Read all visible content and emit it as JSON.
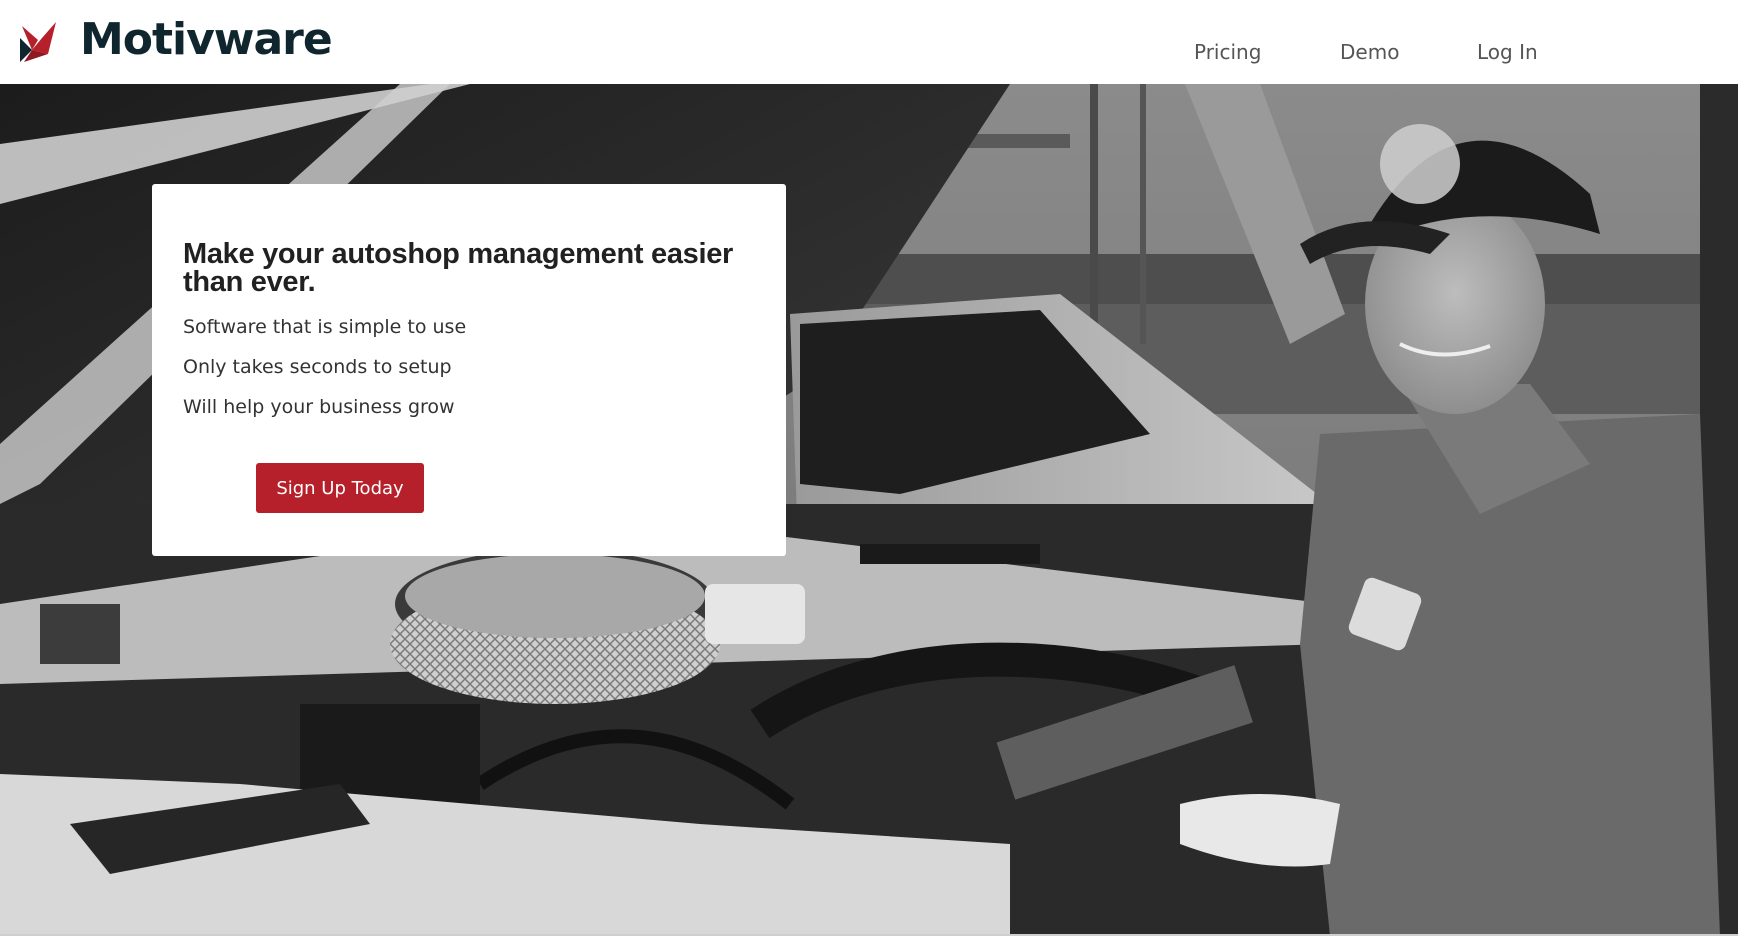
{
  "brand": {
    "name": "Motivware",
    "logo_icon": "motivware-logo-icon",
    "accent_color": "#b5202a",
    "name_color": "#10262f"
  },
  "nav": {
    "items": [
      {
        "label": "Pricing"
      },
      {
        "label": "Demo"
      },
      {
        "label": "Log In"
      }
    ]
  },
  "hero": {
    "image": "black-and-white-mechanic-under-car-hood-photo",
    "headline": "Make your autoshop management easier than ever.",
    "features": [
      "Software that is simple to use",
      "Only takes seconds to setup",
      "Will help your business grow"
    ],
    "cta_label": "Sign Up Today"
  }
}
